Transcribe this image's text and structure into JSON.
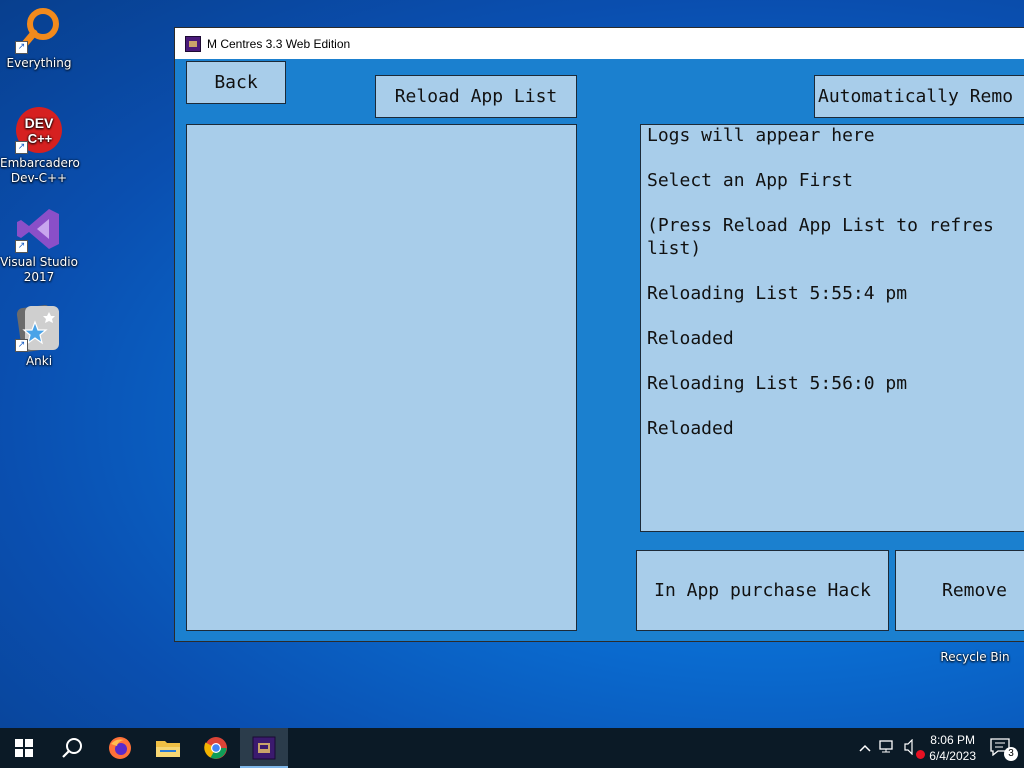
{
  "desktop": {
    "icons": [
      {
        "label": "Everything"
      },
      {
        "label": "Embarcadero Dev-C++"
      },
      {
        "label": "Visual Studio 2017"
      },
      {
        "label": "Anki"
      },
      {
        "label": "Recycle Bin"
      }
    ],
    "devcpp_badge_top": "DEV",
    "devcpp_badge_bottom": "C++"
  },
  "window": {
    "title": "M Centres 3.3 Web Edition",
    "back_label": "Back",
    "reload_label": "Reload App List",
    "auto_remove_label": "Automatically Remo",
    "iap_hack_label": "In App purchase Hack",
    "remove_label": "Remove",
    "logs": "Logs will appear here\n\nSelect an App First\n\n(Press Reload App List to refres\nlist)\n\nReloading List 5:55:4 pm\n\nReloaded\n\nReloading List 5:56:0 pm\n\nReloaded"
  },
  "taskbar": {
    "time": "8:06 PM",
    "date": "6/4/2023",
    "notification_count": "3"
  },
  "colors": {
    "window_bg": "#1b80cf",
    "panel_bg": "#a8cdea",
    "taskbar_bg": "#0b1a26"
  }
}
